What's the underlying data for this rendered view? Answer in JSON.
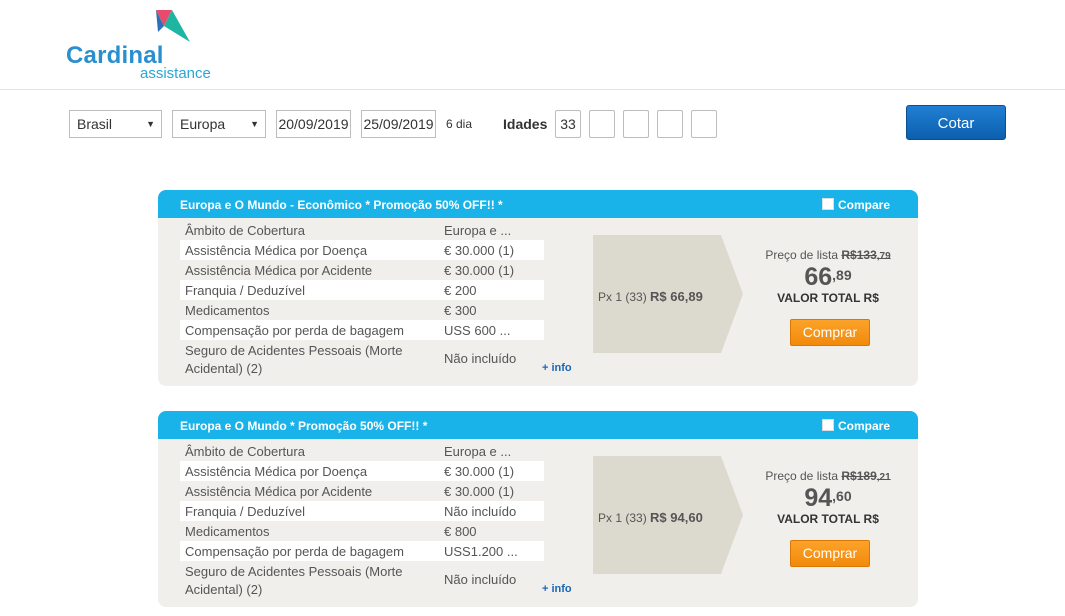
{
  "brand": {
    "name": "Cardinal",
    "tagline": "assistance",
    "colors": {
      "accent": "#19b3ea",
      "primary_button": "#0d5fae",
      "buy_button": "#f28a0b"
    }
  },
  "search": {
    "origin": "Brasil",
    "destination": "Europa",
    "date_from": "20/09/2019",
    "date_to": "25/09/2019",
    "days": "6 dia",
    "ages_label": "Idades",
    "ages": [
      "33",
      "",
      "",
      "",
      ""
    ],
    "submit_label": "Cotar"
  },
  "plans": [
    {
      "title": "Europa e O Mundo - Econômico * Promoção 50% OFF!! *",
      "compare_label": "Compare",
      "coverages": [
        {
          "label": "Âmbito de Cobertura",
          "value": "Europa e ..."
        },
        {
          "label": "Assistência Médica por Doença",
          "value": "€ 30.000 (1)"
        },
        {
          "label": "Assistência Médica por Acidente",
          "value": "€ 30.000 (1)"
        },
        {
          "label": "Franquia / Deduzível",
          "value": "€ 200"
        },
        {
          "label": "Medicamentos",
          "value": "€ 300"
        },
        {
          "label": "Compensação por perda de bagagem",
          "value": "USS 600 ..."
        },
        {
          "label": "Seguro de Acidentes Pessoais (Morte Acidental) (2)",
          "value": "Não incluído"
        }
      ],
      "more_info": "+ info",
      "px_label": "Px 1 (33)",
      "px_price": "R$ 66,89",
      "list_price_label": "Preço de lista",
      "list_price_int": "R$133",
      "list_price_dec": ",79",
      "price_int": "66",
      "price_dec": ",89",
      "total_label": "VALOR TOTAL R$",
      "buy_label": "Comprar"
    },
    {
      "title": "Europa e O Mundo * Promoção 50% OFF!! *",
      "compare_label": "Compare",
      "coverages": [
        {
          "label": "Âmbito de Cobertura",
          "value": "Europa e ..."
        },
        {
          "label": "Assistência Médica por Doença",
          "value": "€ 30.000 (1)"
        },
        {
          "label": "Assistência Médica por Acidente",
          "value": "€ 30.000 (1)"
        },
        {
          "label": "Franquia / Deduzível",
          "value": "Não incluído"
        },
        {
          "label": "Medicamentos",
          "value": "€ 800"
        },
        {
          "label": "Compensação por perda de bagagem",
          "value": "USS1.200 ..."
        },
        {
          "label": "Seguro de Acidentes Pessoais (Morte Acidental) (2)",
          "value": "Não incluído"
        }
      ],
      "more_info": "+ info",
      "px_label": "Px 1 (33)",
      "px_price": "R$ 94,60",
      "list_price_label": "Preço de lista",
      "list_price_int": "R$189",
      "list_price_dec": ",21",
      "price_int": "94",
      "price_dec": ",60",
      "total_label": "VALOR TOTAL R$",
      "buy_label": "Comprar"
    }
  ]
}
